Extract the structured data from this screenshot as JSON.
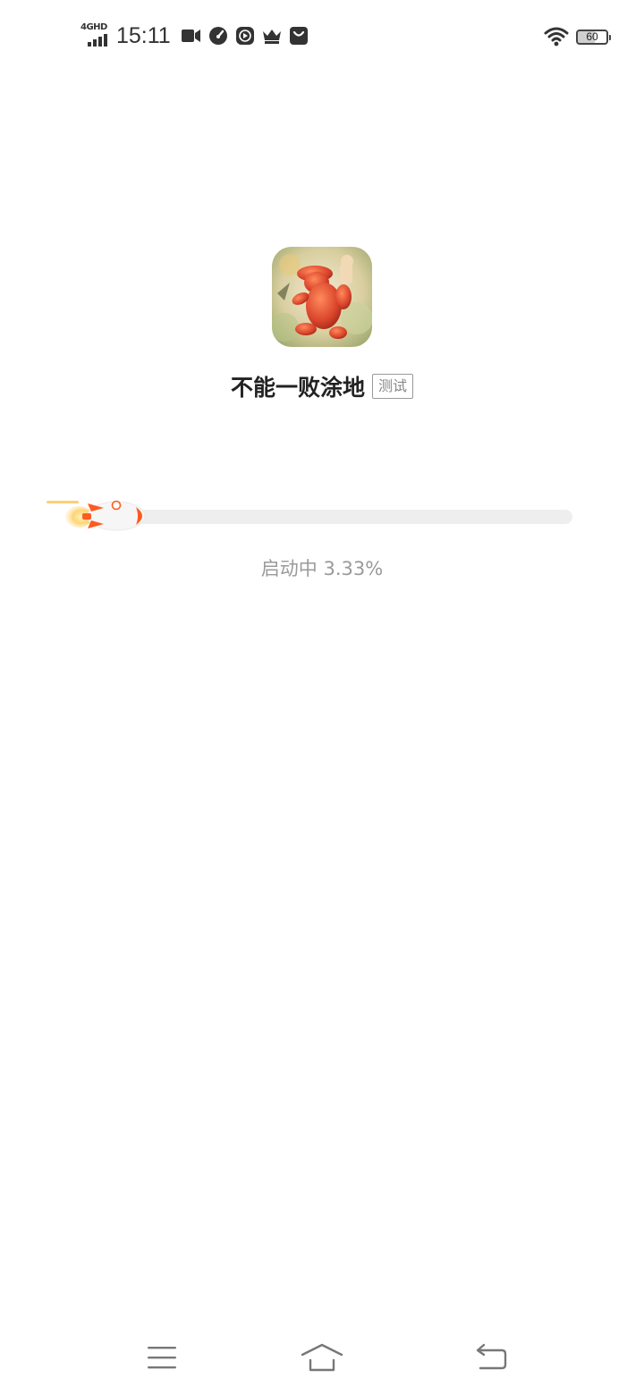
{
  "status_bar": {
    "network": "4GHD",
    "time": "15:11",
    "icons": [
      "video-camera-icon",
      "speed-gauge-icon",
      "play-icon",
      "crown-icon",
      "shopping-bag-icon"
    ],
    "wifi_icon": "wifi-icon",
    "battery_level": "60"
  },
  "app": {
    "icon": "game-app-icon",
    "title": "不能一败涂地",
    "badge": "测试"
  },
  "progress": {
    "text": "启动中 3.33%",
    "percent": 3.33
  },
  "nav_bar": {
    "menu_icon": "menu-icon",
    "home_icon": "home-icon",
    "back_icon": "back-icon"
  },
  "colors": {
    "accent": "#ff5a1f",
    "track": "#eeeeee",
    "text_muted": "#9a9a9a"
  }
}
